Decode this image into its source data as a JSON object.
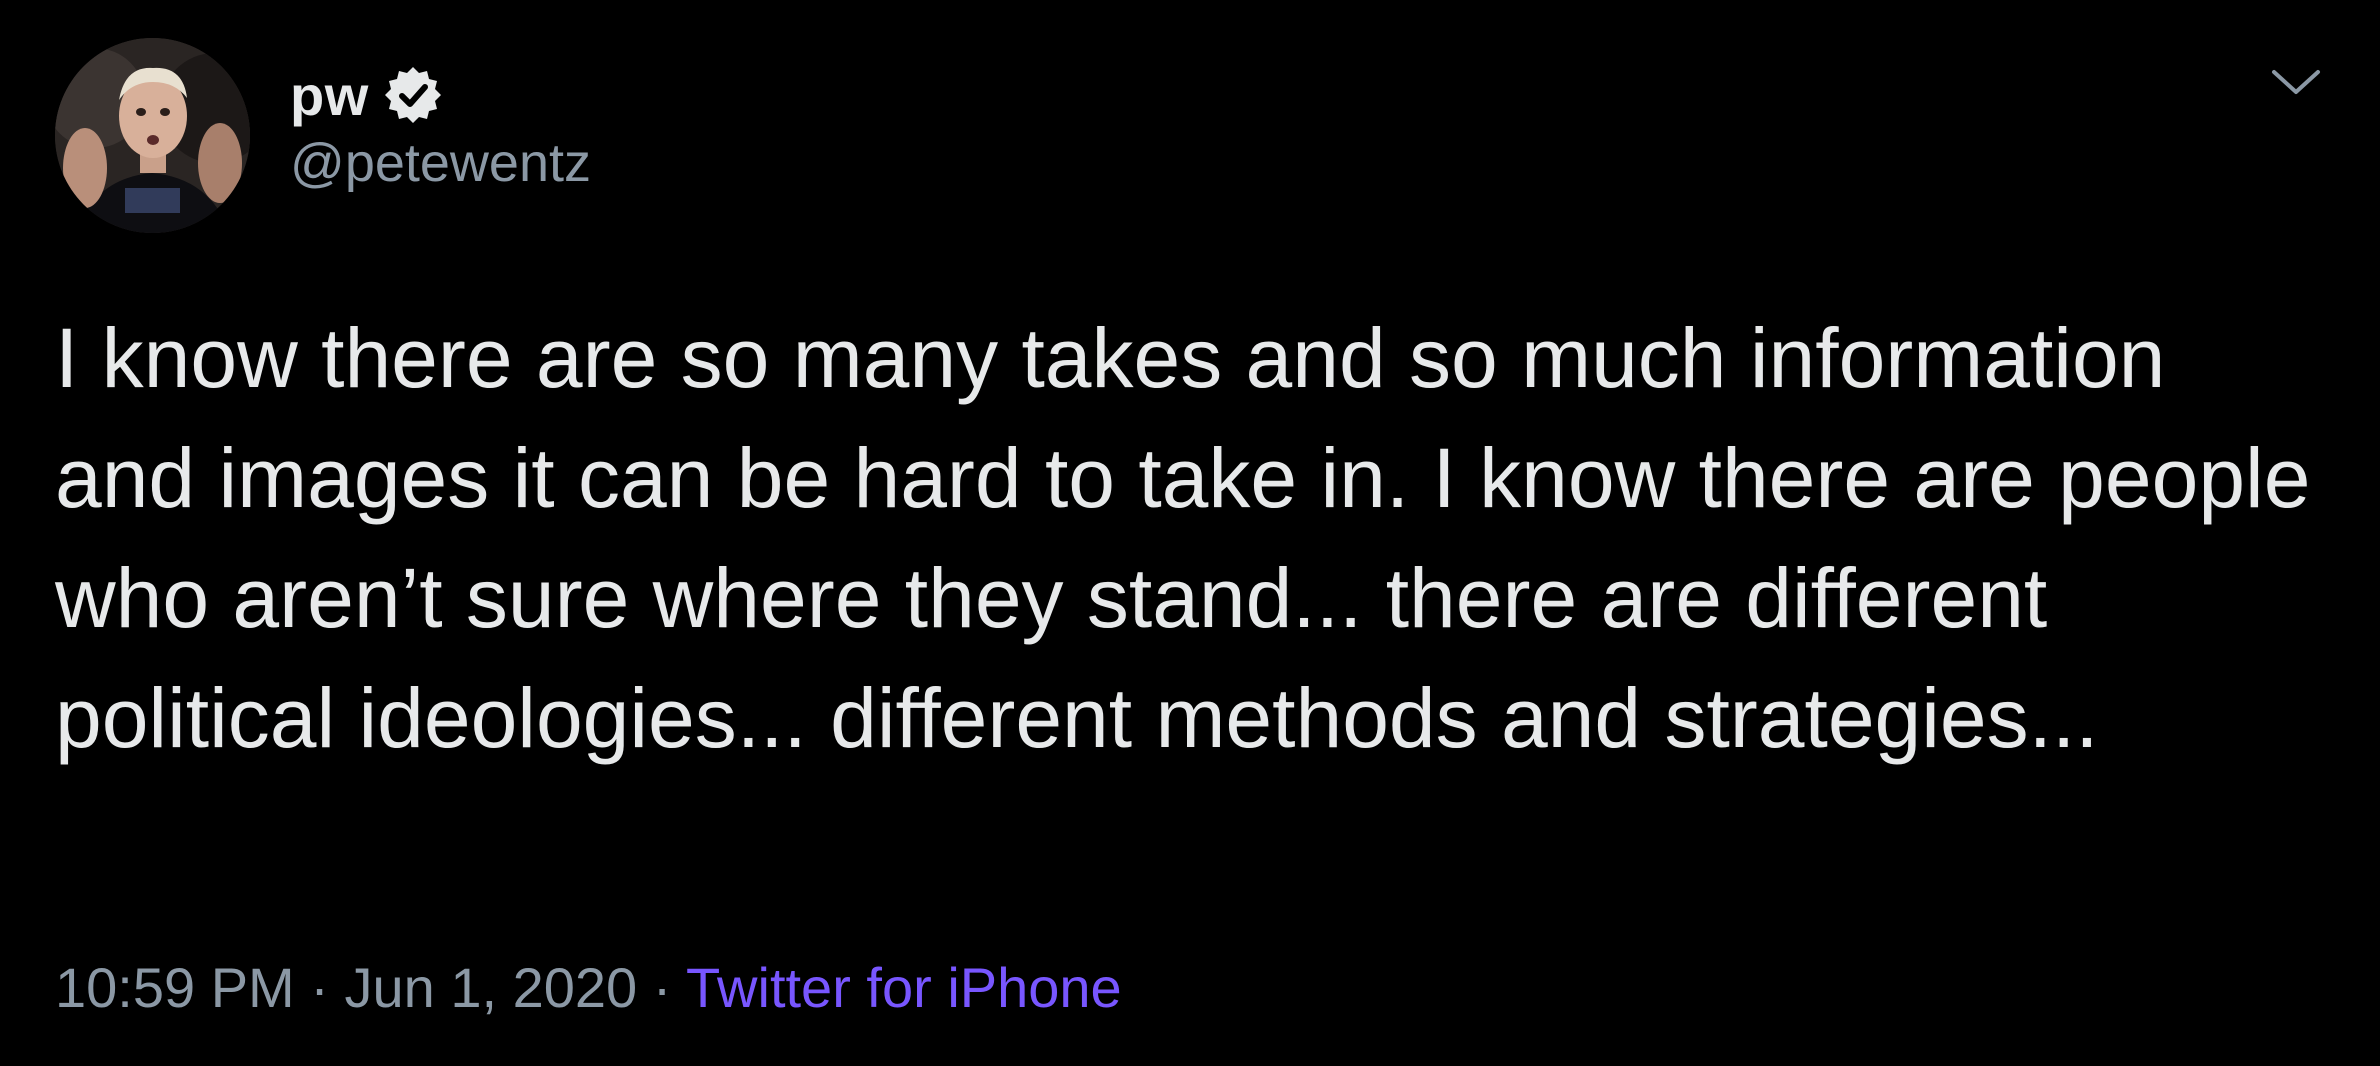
{
  "user": {
    "display_name": "pw",
    "handle": "@petewentz",
    "verified": true
  },
  "tweet": {
    "text": "I know there are so many takes and so much information and images it can be hard to take in. I know there are people who aren’t sure where they stand... there are different political ideologies... different methods and strategies...",
    "time": "10:59 PM",
    "separator": "·",
    "date": "Jun 1, 2020",
    "source": "Twitter for iPhone"
  },
  "icons": {
    "verified": "verified-badge-icon",
    "menu": "chevron-down-icon"
  },
  "colors": {
    "background": "#000000",
    "text": "#e7e9ea",
    "secondary": "#8b98a5",
    "accent": "#7856ff"
  }
}
